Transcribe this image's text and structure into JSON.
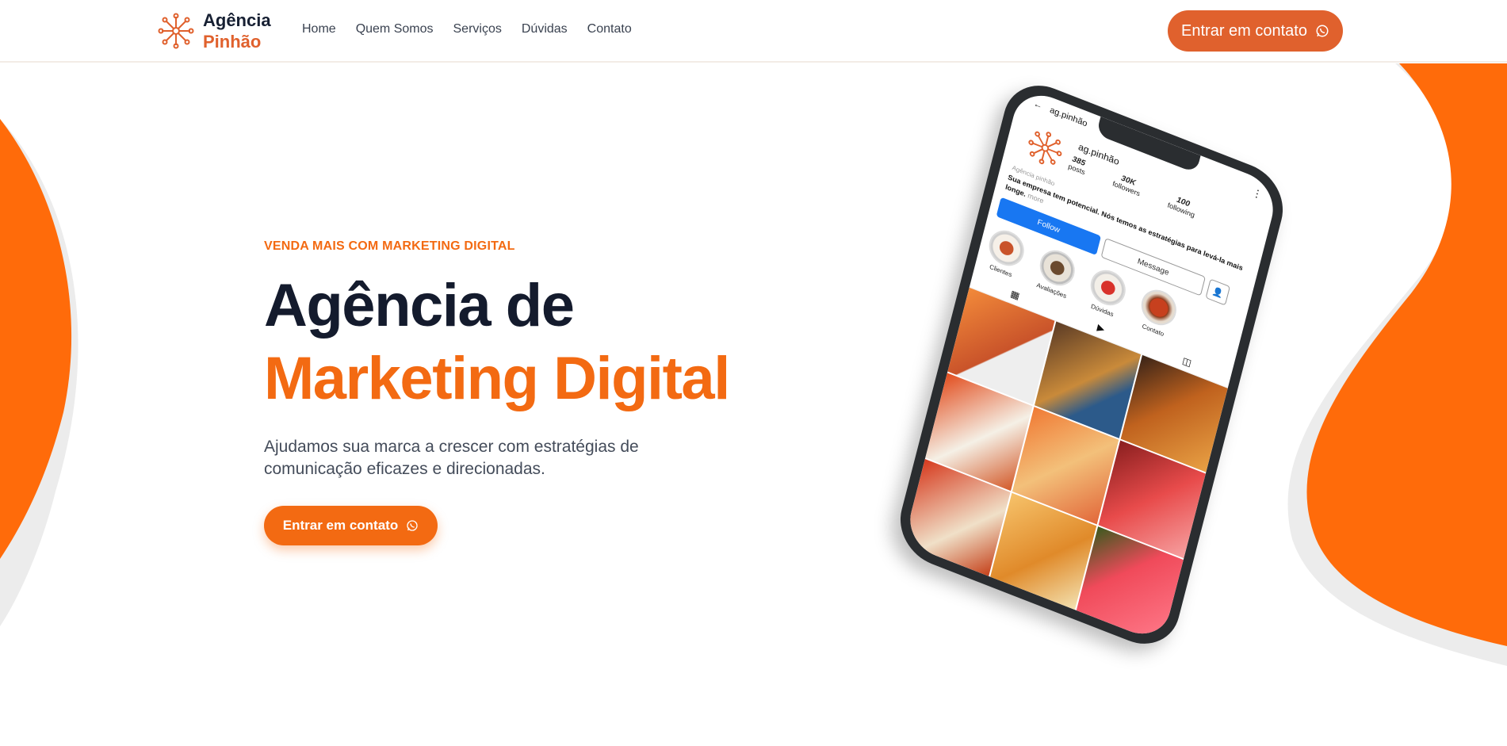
{
  "header": {
    "logo": {
      "line1": "Agência",
      "line2": "Pinhão"
    },
    "nav": [
      {
        "label": "Home"
      },
      {
        "label": "Quem Somos"
      },
      {
        "label": "Serviços"
      },
      {
        "label": "Dúvidas"
      },
      {
        "label": "Contato"
      }
    ],
    "cta_label": "Entrar em contato"
  },
  "hero": {
    "eyebrow": "VENDA MAIS COM MARKETING DIGITAL",
    "headline_line1": "Agência de",
    "headline_line2": "Marketing Digital",
    "subtext": "Ajudamos sua marca a crescer com estratégias de comunicação eficazes e direcionadas.",
    "cta_label": "Entrar em contato"
  },
  "phone": {
    "topbar_user": "ag.pinhão",
    "profile_user": "ag.pinhão",
    "stats": [
      {
        "value": "385",
        "label": "posts"
      },
      {
        "value": "30K",
        "label": "followers"
      },
      {
        "value": "100",
        "label": "following"
      }
    ],
    "bio_name": "Agência pinhão",
    "bio_text": "Sua empresa tem potencial. Nós temos as estratégias para levá-la mais longe.",
    "bio_more": "more",
    "follow_label": "Follow",
    "message_label": "Message",
    "highlights": [
      {
        "label": "Clientes"
      },
      {
        "label": "Avaliações"
      },
      {
        "label": "Dúvidas"
      },
      {
        "label": "Contato"
      }
    ]
  },
  "colors": {
    "brand_orange": "#f36a12",
    "cta_orange": "#e0612d",
    "dark_navy": "#141b2d"
  },
  "icons": {
    "cta": "whatsapp-icon",
    "logo": "flower-logo-icon"
  }
}
